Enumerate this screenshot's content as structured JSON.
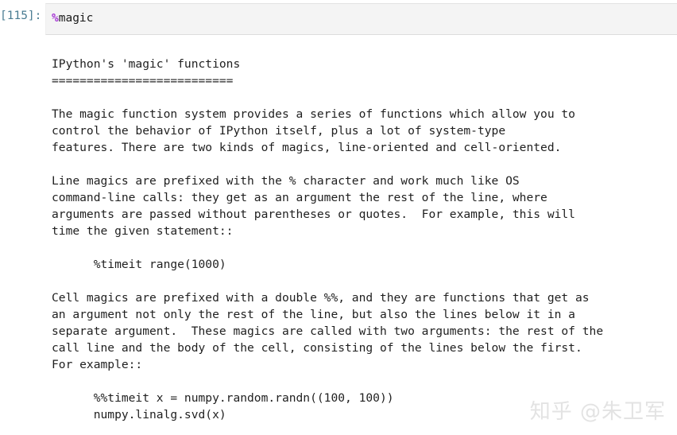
{
  "cell": {
    "prompt": "[115]:",
    "code_magic_sign": "%",
    "code_magic_name": "magic",
    "code_full": "%magic"
  },
  "output": {
    "lines": [
      "IPython's 'magic' functions",
      "==========================",
      "",
      "The magic function system provides a series of functions which allow you to",
      "control the behavior of IPython itself, plus a lot of system-type",
      "features. There are two kinds of magics, line-oriented and cell-oriented.",
      "",
      "Line magics are prefixed with the % character and work much like OS",
      "command-line calls: they get as an argument the rest of the line, where",
      "arguments are passed without parentheses or quotes.  For example, this will",
      "time the given statement::",
      "",
      "      %timeit range(1000)",
      "",
      "Cell magics are prefixed with a double %%, and they are functions that get as",
      "an argument not only the rest of the line, but also the lines below it in a",
      "separate argument.  These magics are called with two arguments: the rest of the",
      "call line and the body of the cell, consisting of the lines below the first.",
      "For example::",
      "",
      "      %%timeit x = numpy.random.randn((100, 100))",
      "      numpy.linalg.svd(x)"
    ]
  },
  "watermark": {
    "text": "知乎 @朱卫军"
  },
  "colors": {
    "prompt": "#4a7c92",
    "magic_sign": "#a535d4",
    "input_background": "#f4f4f4",
    "output_text": "#1f1f1f",
    "watermark": "#e3e3e3",
    "page_background": "#ffffff"
  }
}
